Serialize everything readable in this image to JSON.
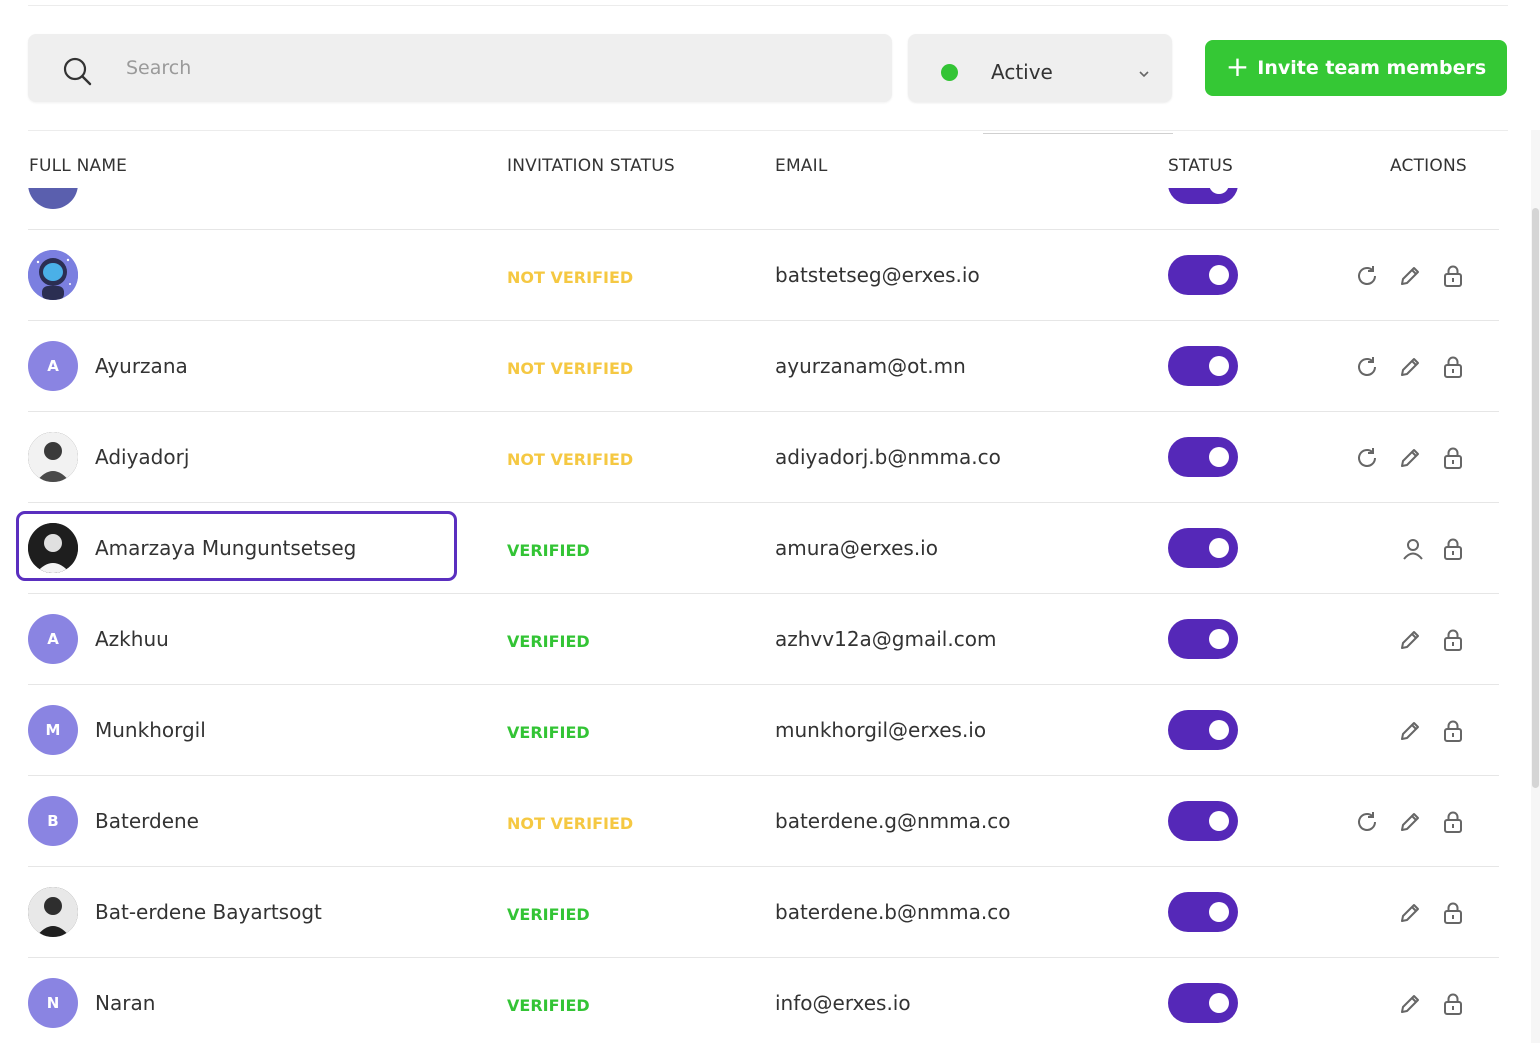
{
  "search": {
    "placeholder": "Search",
    "value": ""
  },
  "filter": {
    "value": "Active",
    "dot_color": "#33c435"
  },
  "invite_button": {
    "label": "Invite team members",
    "plus": "+"
  },
  "table": {
    "headers": {
      "full_name": "FULL NAME",
      "invitation_status": "INVITATION STATUS",
      "email": "EMAIL",
      "status": "STATUS",
      "actions": "ACTIONS"
    },
    "rows": [
      {
        "name": "",
        "avatar_type": "photo",
        "avatar_letter": "",
        "invitation": "",
        "email": "",
        "active": true,
        "actions": []
      },
      {
        "name": "",
        "avatar_type": "astronaut",
        "avatar_letter": "",
        "invitation": "NOT VERIFIED",
        "verified": false,
        "email": "batstetseg@erxes.io",
        "active": true,
        "actions": [
          "resend-icon",
          "edit-icon",
          "lock-icon"
        ]
      },
      {
        "name": "Ayurzana",
        "avatar_type": "letter",
        "avatar_letter": "A",
        "invitation": "NOT VERIFIED",
        "verified": false,
        "email": "ayurzanam@ot.mn",
        "active": true,
        "actions": [
          "resend-icon",
          "edit-icon",
          "lock-icon"
        ]
      },
      {
        "name": "Adiyadorj",
        "avatar_type": "photo",
        "avatar_letter": "",
        "invitation": "NOT VERIFIED",
        "verified": false,
        "email": "adiyadorj.b@nmma.co",
        "active": true,
        "actions": [
          "resend-icon",
          "edit-icon",
          "lock-icon"
        ]
      },
      {
        "name": "Amarzaya Munguntsetseg",
        "avatar_type": "photo",
        "avatar_letter": "",
        "invitation": "VERIFIED",
        "verified": true,
        "email": "amura@erxes.io",
        "active": true,
        "actions": [
          "user-icon",
          "lock-icon"
        ]
      },
      {
        "name": "Azkhuu",
        "avatar_type": "letter",
        "avatar_letter": "A",
        "invitation": "VERIFIED",
        "verified": true,
        "email": "azhvv12a@gmail.com",
        "active": true,
        "actions": [
          "edit-icon",
          "lock-icon"
        ]
      },
      {
        "name": "Munkhorgil",
        "avatar_type": "letter",
        "avatar_letter": "M",
        "invitation": "VERIFIED",
        "verified": true,
        "email": "munkhorgil@erxes.io",
        "active": true,
        "actions": [
          "edit-icon",
          "lock-icon"
        ]
      },
      {
        "name": "Baterdene",
        "avatar_type": "letter",
        "avatar_letter": "B",
        "invitation": "NOT VERIFIED",
        "verified": false,
        "email": "baterdene.g@nmma.co",
        "active": true,
        "actions": [
          "resend-icon",
          "edit-icon",
          "lock-icon"
        ]
      },
      {
        "name": "Bat-erdene Bayartsogt",
        "avatar_type": "photo",
        "avatar_letter": "",
        "invitation": "VERIFIED",
        "verified": true,
        "email": "baterdene.b@nmma.co",
        "active": true,
        "actions": [
          "edit-icon",
          "lock-icon"
        ]
      },
      {
        "name": "Naran",
        "avatar_type": "letter",
        "avatar_letter": "N",
        "invitation": "VERIFIED",
        "verified": true,
        "email": "info@erxes.io",
        "active": true,
        "actions": [
          "edit-icon",
          "lock-icon"
        ]
      }
    ]
  },
  "colors": {
    "accent": "#5528b8",
    "invite_green": "#35c835",
    "verified": "#33c435",
    "not_verified": "#f5c842",
    "avatar_letter_bg": "#8a84e2"
  }
}
